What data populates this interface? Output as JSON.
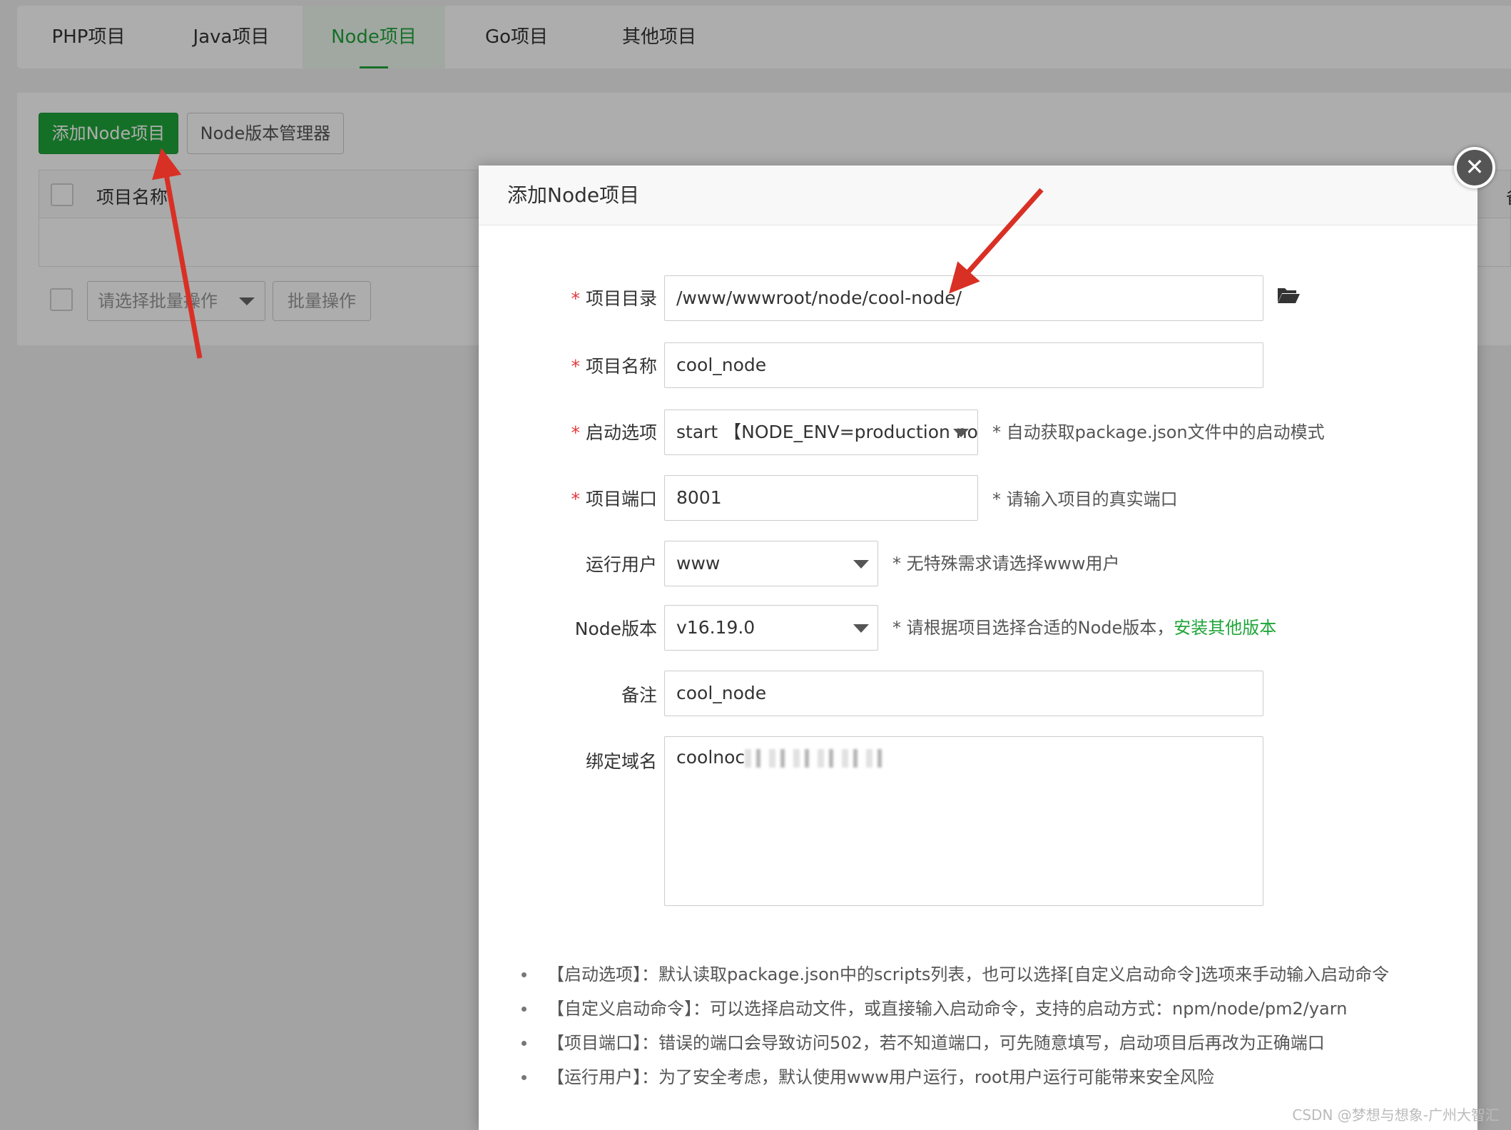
{
  "tabs": [
    {
      "label": "PHP项目"
    },
    {
      "label": "Java项目"
    },
    {
      "label": "Node项目"
    },
    {
      "label": "Go项目"
    },
    {
      "label": "其他项目"
    }
  ],
  "toolbar": {
    "add_node_label": "添加Node项目",
    "version_manager_label": "Node版本管理器"
  },
  "table": {
    "col_name": "项目名称",
    "col_remark_partial": "备注"
  },
  "batch": {
    "select_placeholder": "请选择批量操作",
    "apply_label": "批量操作"
  },
  "modal": {
    "title": "添加Node项目",
    "close_glyph": "✕",
    "required_mark": "*",
    "fields": {
      "project_dir": {
        "label": "项目目录",
        "value": "/www/wwwroot/node/cool-node/"
      },
      "project_name": {
        "label": "项目名称",
        "value": "cool_node"
      },
      "start_option": {
        "label": "启动选项",
        "value": "start 【NODE_ENV=production no…",
        "hint": "* 自动获取package.json文件中的启动模式"
      },
      "port": {
        "label": "项目端口",
        "value": "8001",
        "hint": "* 请输入项目的真实端口"
      },
      "run_user": {
        "label": "运行用户",
        "value": "www",
        "hint": "* 无特殊需求请选择www用户"
      },
      "node_version": {
        "label": "Node版本",
        "value": "v16.19.0",
        "hint": "* 请根据项目选择合适的Node版本，",
        "hint_link": "安装其他版本"
      },
      "remark": {
        "label": "备注",
        "value": "cool_node"
      },
      "domain": {
        "label": "绑定域名",
        "value_prefix": "coolnoc"
      }
    },
    "tips": [
      "【启动选项】：默认读取package.json中的scripts列表，也可以选择[自定义启动命令]选项来手动输入启动命令",
      "【自定义启动命令】：可以选择启动文件，或直接输入启动命令，支持的启动方式：npm/node/pm2/yarn",
      "【项目端口】：错误的端口会导致访问502，若不知道端口，可先随意填写，启动项目后再改为正确端口",
      "【运行用户】：为了安全考虑，默认使用www用户运行，root用户运行可能带来安全风险"
    ]
  },
  "watermark": "CSDN @梦想与想象-广州大智汇",
  "colors": {
    "accent_green": "#20a53a",
    "required_red": "#e4393c",
    "annotation_arrow": "#d93025"
  },
  "icons": {
    "folder": "folder-open-icon",
    "close": "close-icon",
    "caret": "chevron-down-icon"
  }
}
